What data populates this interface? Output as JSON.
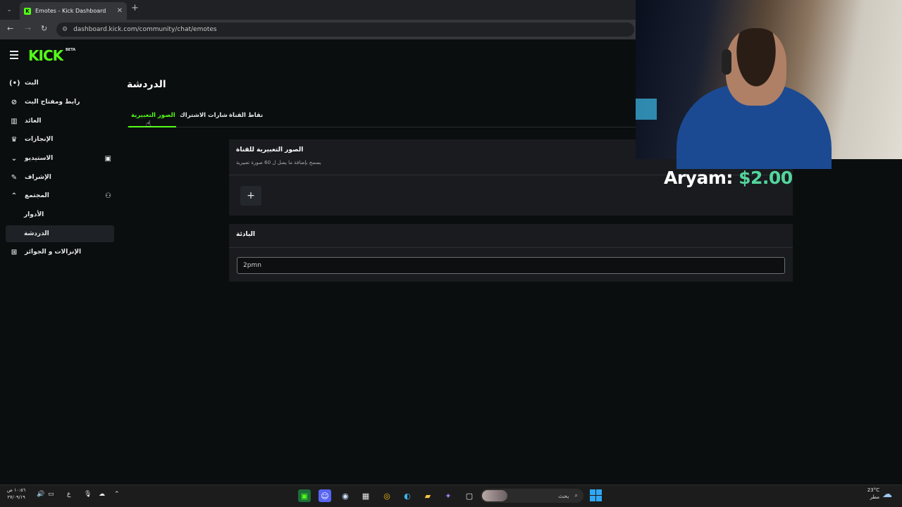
{
  "browser": {
    "tab_title": "Emotes - Kick Dashboard",
    "tab_favicon": "K",
    "tab_close": "✕",
    "new_tab": "+",
    "url": "dashboard.kick.com/community/chat/emotes"
  },
  "app": {
    "logo": "KICK",
    "logo_badge": "BETA",
    "sidebar": [
      {
        "label": "البث",
        "icon": "broadcast-icon"
      },
      {
        "label": "رابط ومفتاح البث",
        "icon": "link-icon"
      },
      {
        "label": "العائد",
        "icon": "chart-icon"
      },
      {
        "label": "الإنجازات",
        "icon": "trophy-icon"
      },
      {
        "label": "الاستيديو",
        "icon": "chevron-down-icon"
      },
      {
        "label": "الإشراف",
        "icon": "wrench-icon"
      },
      {
        "label": "المجتمع",
        "icon": "chevron-up-icon"
      },
      {
        "label": "الأدوار",
        "icon": ""
      },
      {
        "label": "الدردشة",
        "icon": ""
      },
      {
        "label": "الإنزالات و الجوائز",
        "icon": "drops-icon"
      }
    ],
    "page_title": "الدردشة",
    "tabs": [
      "الصور التعبيرية",
      "شارات الاشتراك",
      "نقاط القناة"
    ],
    "active_tab": "الصور التعبيرية",
    "emotes_card": {
      "title": "الصور التعبيرية للقناة",
      "subtitle": "يسمح بإضافة ما يصل ل 60 صورة تعبيرية",
      "add_label": "+"
    },
    "prefix_card": {
      "title": "البادئة",
      "input_value": "2pmn"
    }
  },
  "overlay": {
    "donor": "Aryam:",
    "amount": "$2.00"
  },
  "taskbar": {
    "time": "١٠:٥٦ ص",
    "date": "٢٧/٠٩/١٩",
    "lang": "ع",
    "search_label": "بحث",
    "weather_temp": "23°C",
    "weather_text": "مطر"
  },
  "colors": {
    "accent": "#53fc18",
    "donation_amount": "#53d59c",
    "card_bg": "#191b1f",
    "app_bg": "#0b0e0f"
  }
}
